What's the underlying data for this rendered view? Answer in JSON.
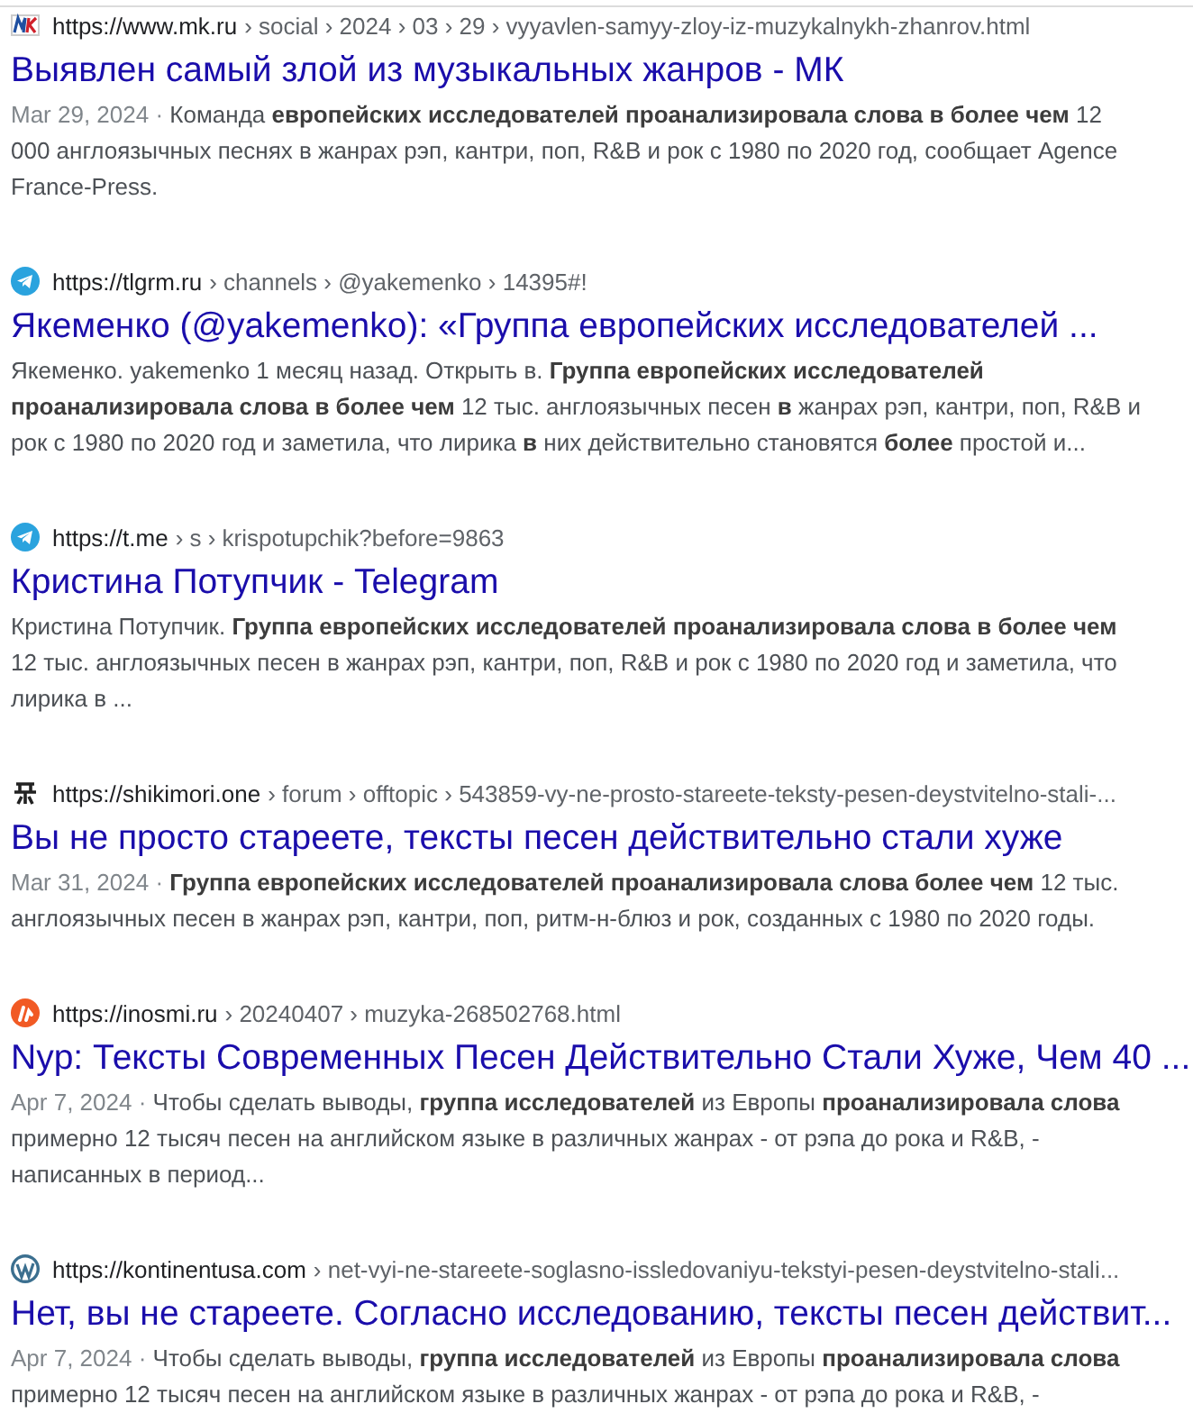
{
  "results": [
    {
      "kind": "mk",
      "site": "https://www.mk.ru",
      "path": "› social › 2024 › 03 › 29 › vyyavlen-samyy-zloy-iz-muzykalnykh-zhanrov.html",
      "title": "Выявлен самый злой из музыкальных жанров - МК",
      "date": "Mar 29, 2024 ·",
      "snippet": "Команда **европейских исследователей проанализировала слова в более чем** 12 000 англоязычных песнях в жанрах рэп, кантри, поп, R&B и рок с 1980 по 2020 год, сообщает Agence France-Press."
    },
    {
      "kind": "telegram",
      "site": "https://tlgrm.ru",
      "path": "› channels › @yakemenko › 14395#!",
      "title": "Якеменко (@yakemenko): «Группа европейских исследователей ...",
      "snippet": "Якеменко. yakemenko 1 месяц назад. Открыть в. **Группа европейских исследователей проанализировала слова в более чем** 12 тыс. англоязычных песен **в** жанрах рэп, кантри, поп, R&B и рок с 1980 по 2020 год и заметила, что лирика **в** них действительно становятся **более** простой и..."
    },
    {
      "kind": "telegram",
      "site": "https://t.me",
      "path": "› s › krispotupchik?before=9863",
      "title": "Кристина Потупчик - Telegram",
      "snippet": "Кристина Потупчик. **Группа европейских исследователей проанализировала слова в более чем** 12 тыс. англоязычных песен в жанрах рэп, кантри, поп, R&B и рок с 1980 по 2020 год и заметила, что лирика в ..."
    },
    {
      "kind": "shikimori",
      "site": "https://shikimori.one",
      "path": "› forum › offtopic › 543859-vy-ne-prosto-stareete-teksty-pesen-deystvitelno-stali-...",
      "title": "Вы не просто стареете, тексты песен действительно стали хуже",
      "date": "Mar 31, 2024 ·",
      "snippet": "**Группа европейских исследователей проанализировала слова более чем** 12 тыс. англоязычных песен в жанрах рэп, кантри, поп, ритм-н-блюз и рок, созданных с 1980 по 2020 годы."
    },
    {
      "kind": "inosmi",
      "site": "https://inosmi.ru",
      "path": "› 20240407 › muzyka-268502768.html",
      "title": "Nyp: Тексты Современных Песен Действительно Стали Хуже, Чем 40 ...",
      "date": "Apr 7, 2024 ·",
      "snippet": "Чтобы сделать выводы, **группа исследователей** из Европы **проанализировала слова** примерно 12 тысяч песен на английском языке в различных жанрах - от рэпа до рока и R&B, - написанных в период..."
    },
    {
      "kind": "wordpress",
      "site": "https://kontinentusa.com",
      "path": "› net-vyi-ne-stareete-soglasno-issledovaniyu-tekstyi-pesen-deystvitelno-stali...",
      "title": "Нет, вы не стареете. Согласно исследованию, тексты песен действит...",
      "date": "Apr 7, 2024 ·",
      "snippet": "Чтобы сделать выводы, **группа исследователей** из Европы **проанализировала слова** примерно 12 тысяч песен на английском языке в различных жанрах - от рэпа до рока и R&B, -"
    }
  ]
}
